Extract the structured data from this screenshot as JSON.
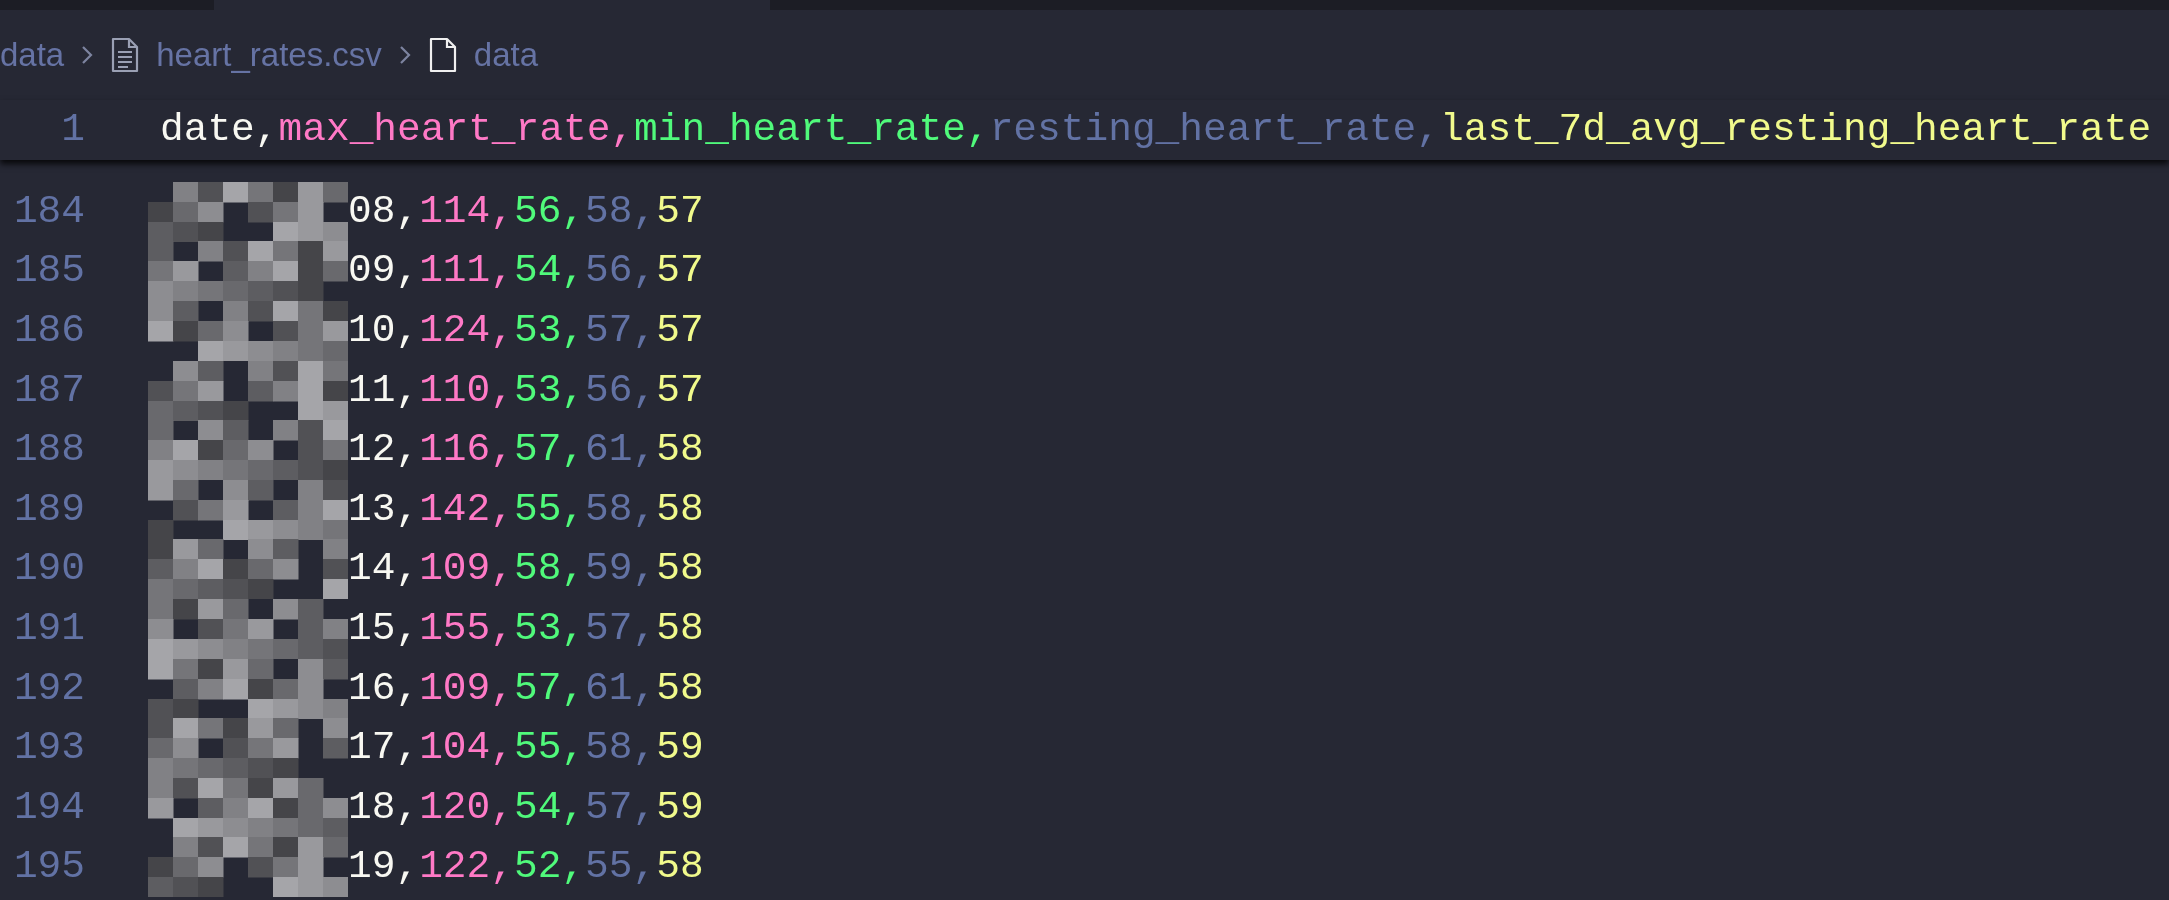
{
  "breadcrumbs": [
    {
      "kind": "folder",
      "label": "data"
    },
    {
      "kind": "file-lines",
      "label": "heart_rates.csv"
    },
    {
      "kind": "file",
      "label": "data"
    }
  ],
  "header": {
    "line": "1",
    "fields": [
      {
        "text": "date,",
        "color": "#f8f8f2"
      },
      {
        "text": "max_heart_rate,",
        "color": "#ff79c6"
      },
      {
        "text": "min_heart_rate,",
        "color": "#50fa7b"
      },
      {
        "text": "resting_heart_rate,",
        "color": "#6272a4"
      },
      {
        "text": "last_7d_avg_resting_heart_rate",
        "color": "#f1fa8c"
      }
    ]
  },
  "rows": [
    {
      "line": "184",
      "fields": [
        "08,",
        "114,",
        "56,",
        "58,",
        "57"
      ]
    },
    {
      "line": "185",
      "fields": [
        "09,",
        "111,",
        "54,",
        "56,",
        "57"
      ]
    },
    {
      "line": "186",
      "fields": [
        "10,",
        "124,",
        "53,",
        "57,",
        "57"
      ]
    },
    {
      "line": "187",
      "fields": [
        "11,",
        "110,",
        "53,",
        "56,",
        "57"
      ]
    },
    {
      "line": "188",
      "fields": [
        "12,",
        "116,",
        "57,",
        "61,",
        "58"
      ]
    },
    {
      "line": "189",
      "fields": [
        "13,",
        "142,",
        "55,",
        "58,",
        "58"
      ]
    },
    {
      "line": "190",
      "fields": [
        "14,",
        "109,",
        "58,",
        "59,",
        "58"
      ]
    },
    {
      "line": "191",
      "fields": [
        "15,",
        "155,",
        "53,",
        "57,",
        "58"
      ]
    },
    {
      "line": "192",
      "fields": [
        "16,",
        "109,",
        "57,",
        "61,",
        "58"
      ]
    },
    {
      "line": "193",
      "fields": [
        "17,",
        "104,",
        "55,",
        "58,",
        "59"
      ]
    },
    {
      "line": "194",
      "fields": [
        "18,",
        "120,",
        "54,",
        "57,",
        "59"
      ]
    },
    {
      "line": "195",
      "fields": [
        "19,",
        "122,",
        "52,",
        "55,",
        "58"
      ]
    }
  ]
}
